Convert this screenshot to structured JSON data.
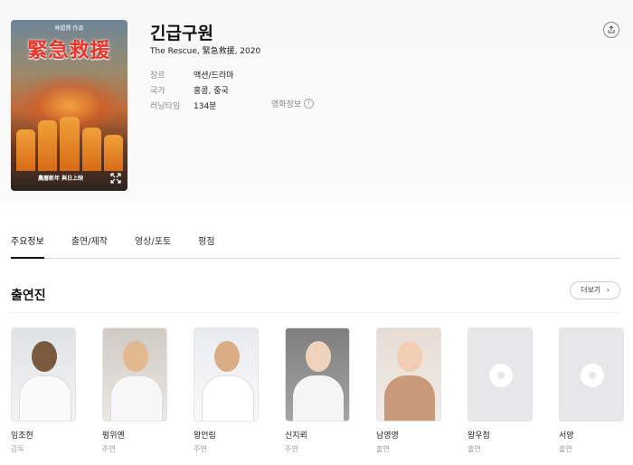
{
  "movie": {
    "title": "긴급구원",
    "subtitle": "The Rescue, 緊急救援, 2020",
    "poster_title": "緊急救援",
    "poster_tagline": "林超賢 作品",
    "poster_release": "農曆新年 與日上映",
    "meta": [
      {
        "label": "장르",
        "value": "액션/드라마"
      },
      {
        "label": "국가",
        "value": "홍콩, 중국"
      },
      {
        "label": "러닝타임",
        "value": "134분"
      }
    ],
    "more_info_label": "영화정보",
    "share_icon": "share-icon",
    "expand_icon": "expand-icon"
  },
  "tabs": [
    {
      "label": "주요정보",
      "active": true
    },
    {
      "label": "출연/제작",
      "active": false
    },
    {
      "label": "영상/포토",
      "active": false
    },
    {
      "label": "평점",
      "active": false
    }
  ],
  "cast_section": {
    "title": "출연진",
    "more_label": "더보기",
    "people": [
      {
        "name": "임조현",
        "role": "감독",
        "has_photo": true
      },
      {
        "name": "펑위옌",
        "role": "주연",
        "has_photo": true
      },
      {
        "name": "왕언림",
        "role": "주연",
        "has_photo": true
      },
      {
        "name": "신지뢰",
        "role": "주연",
        "has_photo": true
      },
      {
        "name": "남영영",
        "role": "출연",
        "has_photo": true
      },
      {
        "name": "왕우첨",
        "role": "출연",
        "has_photo": false
      },
      {
        "name": "서양",
        "role": "출연",
        "has_photo": false
      }
    ]
  },
  "colors": {
    "accent": "#111111",
    "muted": "#8a8a8a",
    "placeholder": "#e6e7e9"
  }
}
